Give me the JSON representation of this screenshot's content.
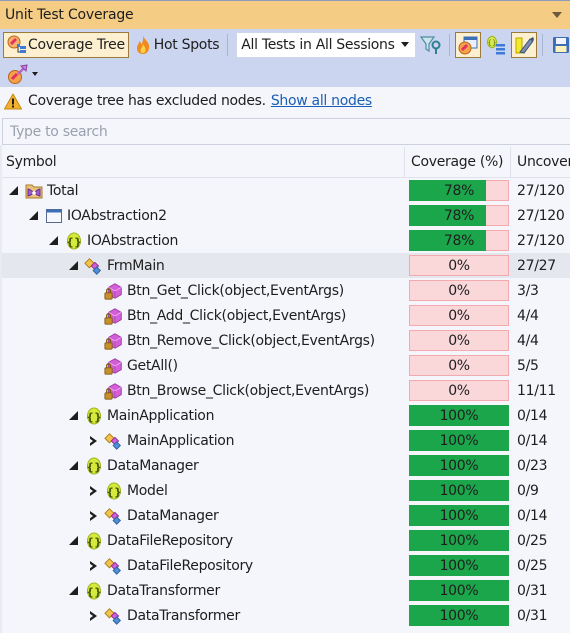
{
  "window": {
    "title": "Unit Test Coverage"
  },
  "toolbar": {
    "coverage_tree_label": "Coverage Tree",
    "coverage_tree_checked": true,
    "hot_spots_label": "Hot Spots",
    "session_filter": {
      "selected": "All Tests in All Sessions"
    },
    "icons": {
      "coverage_tree": "coverage-tree-icon",
      "hot_spots": "flame-icon",
      "filter": "filter-settings-icon",
      "show_coverage_window": "coverage-window-icon",
      "show_namespaces": "namespace-list-icon",
      "highlight": "highlighter-icon",
      "save": "save-icon",
      "navigate": "navigate-icon"
    }
  },
  "notice": {
    "text": "Coverage tree has excluded nodes.",
    "link": "Show all nodes",
    "icon": "warning-icon"
  },
  "search": {
    "placeholder": "Type to search",
    "value": ""
  },
  "columns": {
    "symbol": "Symbol",
    "coverage": "Coverage (%)",
    "uncovered": "Uncover"
  },
  "colors": {
    "covered": "#1ba64b",
    "uncovered": "#fad7d9",
    "uncovered_border": "#f3a9ae",
    "title_bar": "#f5cc84",
    "toolbar": "#ccd5f0",
    "link": "#1a5fb4"
  },
  "rows": [
    {
      "name": "Total",
      "level": 0,
      "expander": "expanded",
      "icon": "solution-icon",
      "coverage": 78,
      "coverage_label": "78%",
      "uncovered": "27/120"
    },
    {
      "name": "IOAbstraction2",
      "level": 1,
      "expander": "expanded",
      "icon": "assembly-icon",
      "coverage": 78,
      "coverage_label": "78%",
      "uncovered": "27/120"
    },
    {
      "name": "IOAbstraction",
      "level": 2,
      "expander": "expanded",
      "icon": "namespace-icon",
      "coverage": 78,
      "coverage_label": "78%",
      "uncovered": "27/120"
    },
    {
      "name": "FrmMain",
      "level": 3,
      "expander": "expanded",
      "icon": "class-icon",
      "coverage": 0,
      "coverage_label": "0%",
      "uncovered": "27/27",
      "selected": true
    },
    {
      "name": "Btn_Get_Click(object,EventArgs)",
      "level": 4,
      "expander": "none",
      "icon": "private-method-icon",
      "coverage": 0,
      "coverage_label": "0%",
      "uncovered": "3/3"
    },
    {
      "name": "Btn_Add_Click(object,EventArgs)",
      "level": 4,
      "expander": "none",
      "icon": "private-method-icon",
      "coverage": 0,
      "coverage_label": "0%",
      "uncovered": "4/4"
    },
    {
      "name": "Btn_Remove_Click(object,EventArgs)",
      "level": 4,
      "expander": "none",
      "icon": "private-method-icon",
      "coverage": 0,
      "coverage_label": "0%",
      "uncovered": "4/4"
    },
    {
      "name": "GetAll()",
      "level": 4,
      "expander": "none",
      "icon": "private-method-icon",
      "coverage": 0,
      "coverage_label": "0%",
      "uncovered": "5/5"
    },
    {
      "name": "Btn_Browse_Click(object,EventArgs)",
      "level": 4,
      "expander": "none",
      "icon": "private-method-icon",
      "coverage": 0,
      "coverage_label": "0%",
      "uncovered": "11/11"
    },
    {
      "name": "MainApplication",
      "level": 3,
      "expander": "expanded",
      "icon": "namespace-icon",
      "coverage": 100,
      "coverage_label": "100%",
      "uncovered": "0/14"
    },
    {
      "name": "MainApplication",
      "level": 4,
      "expander": "collapsed",
      "icon": "class-icon",
      "coverage": 100,
      "coverage_label": "100%",
      "uncovered": "0/14"
    },
    {
      "name": "DataManager",
      "level": 3,
      "expander": "expanded",
      "icon": "namespace-icon",
      "coverage": 100,
      "coverage_label": "100%",
      "uncovered": "0/23"
    },
    {
      "name": "Model",
      "level": 4,
      "expander": "collapsed",
      "icon": "namespace-icon",
      "coverage": 100,
      "coverage_label": "100%",
      "uncovered": "0/9"
    },
    {
      "name": "DataManager",
      "level": 4,
      "expander": "collapsed",
      "icon": "class-icon",
      "coverage": 100,
      "coverage_label": "100%",
      "uncovered": "0/14"
    },
    {
      "name": "DataFileRepository",
      "level": 3,
      "expander": "expanded",
      "icon": "namespace-icon",
      "coverage": 100,
      "coverage_label": "100%",
      "uncovered": "0/25"
    },
    {
      "name": "DataFileRepository",
      "level": 4,
      "expander": "collapsed",
      "icon": "class-icon",
      "coverage": 100,
      "coverage_label": "100%",
      "uncovered": "0/25"
    },
    {
      "name": "DataTransformer",
      "level": 3,
      "expander": "expanded",
      "icon": "namespace-icon",
      "coverage": 100,
      "coverage_label": "100%",
      "uncovered": "0/31"
    },
    {
      "name": "DataTransformer",
      "level": 4,
      "expander": "collapsed",
      "icon": "class-icon",
      "coverage": 100,
      "coverage_label": "100%",
      "uncovered": "0/31"
    }
  ]
}
